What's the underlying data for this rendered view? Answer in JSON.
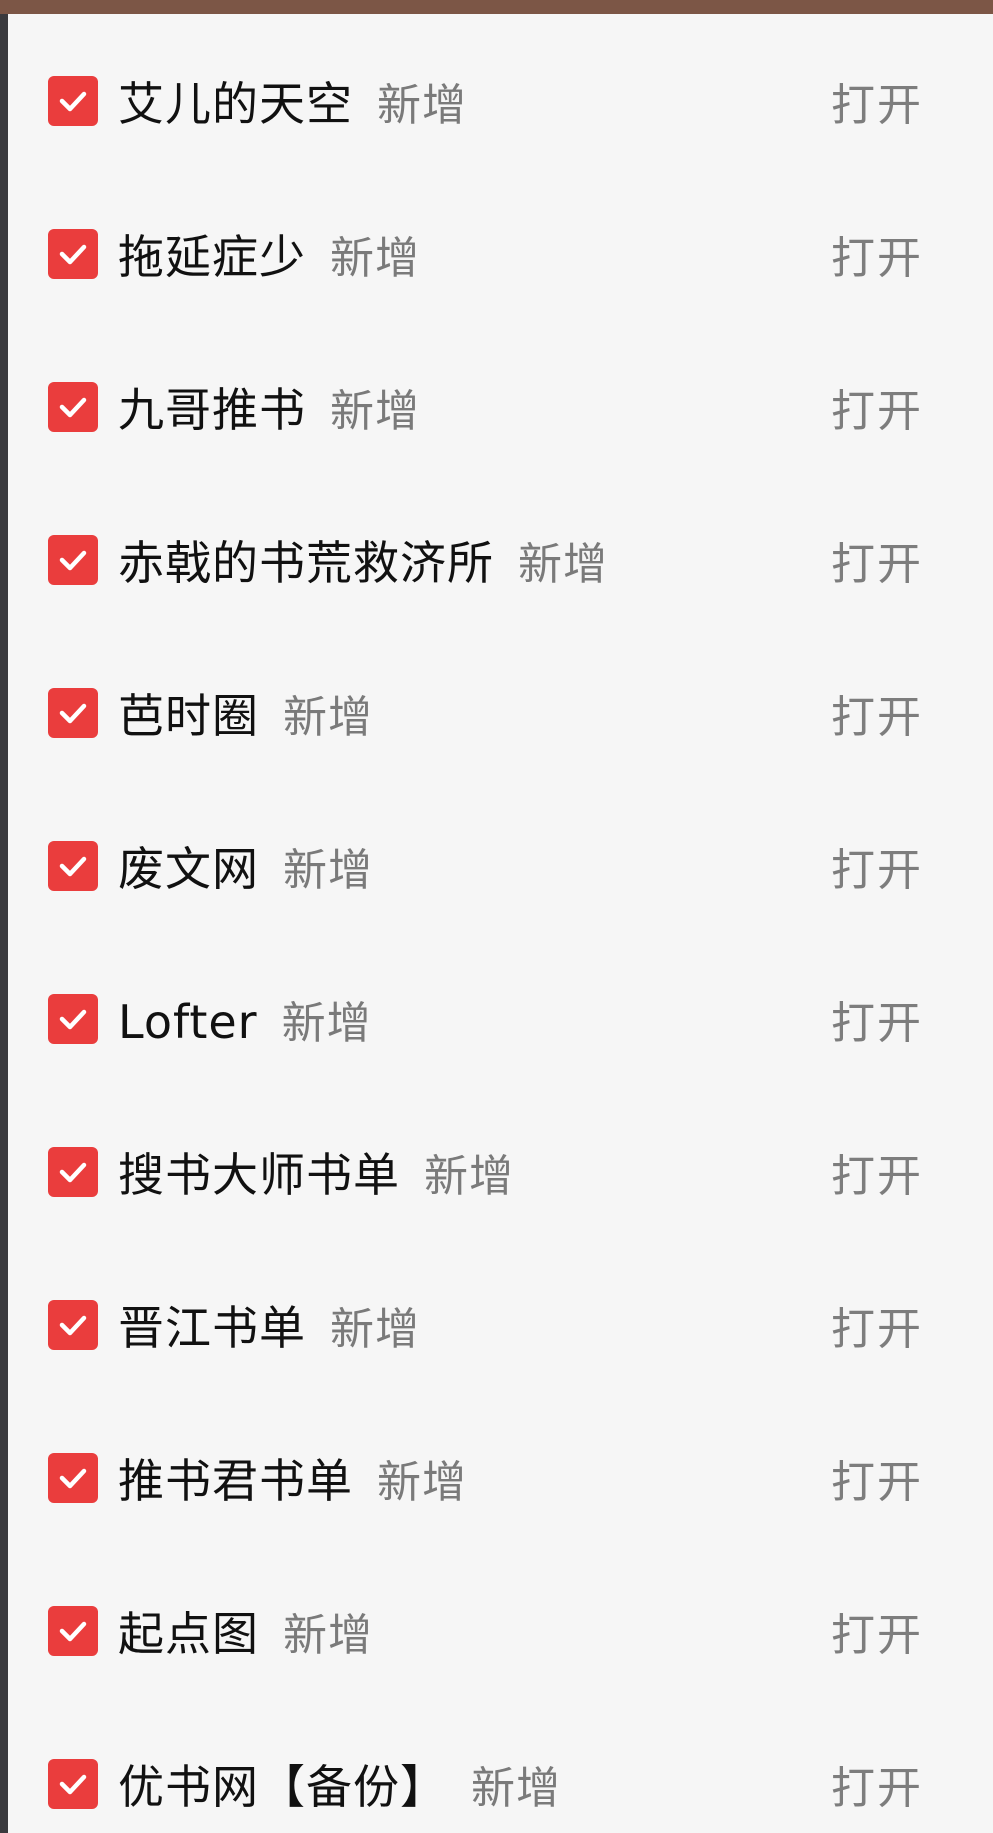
{
  "items": [
    {
      "title": "艾儿的天空",
      "tag": "新增",
      "action": "打开",
      "checked": true
    },
    {
      "title": "拖延症少",
      "tag": "新增",
      "action": "打开",
      "checked": true
    },
    {
      "title": "九哥推书",
      "tag": "新增",
      "action": "打开",
      "checked": true
    },
    {
      "title": "赤戟的书荒救济所",
      "tag": "新增",
      "action": "打开",
      "checked": true
    },
    {
      "title": "芭时圈",
      "tag": "新增",
      "action": "打开",
      "checked": true
    },
    {
      "title": "废文网",
      "tag": "新增",
      "action": "打开",
      "checked": true
    },
    {
      "title": "Lofter",
      "tag": "新增",
      "action": "打开",
      "checked": true
    },
    {
      "title": "搜书大师书单",
      "tag": "新增",
      "action": "打开",
      "checked": true
    },
    {
      "title": "晋江书单",
      "tag": "新增",
      "action": "打开",
      "checked": true
    },
    {
      "title": "推书君书单",
      "tag": "新增",
      "action": "打开",
      "checked": true
    },
    {
      "title": "起点图",
      "tag": "新增",
      "action": "打开",
      "checked": true
    },
    {
      "title": "优书网【备份】",
      "tag": "新增",
      "action": "打开",
      "checked": true
    }
  ],
  "colors": {
    "checkbox": "#ea3d3d",
    "background": "#f6f6f6",
    "title_text": "#111111",
    "tag_text": "#7a7a7a",
    "top_bar": "#7c5646"
  },
  "icons": {
    "checkbox": "check-icon"
  }
}
